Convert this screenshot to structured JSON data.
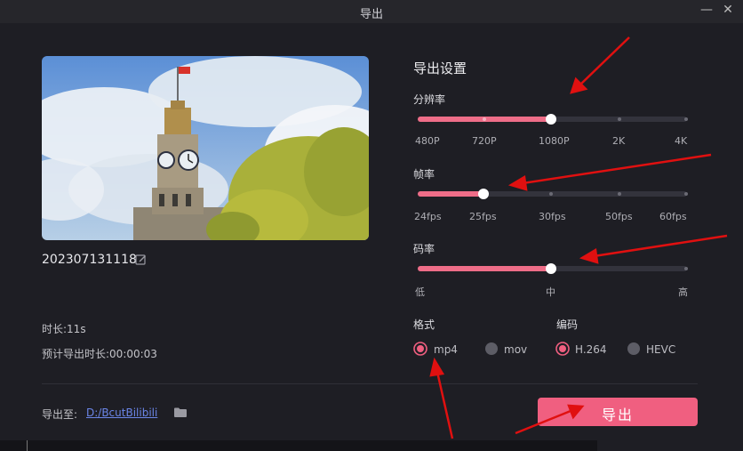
{
  "window": {
    "title": "导出",
    "minimize_icon": "minimize-icon",
    "close_icon": "close-icon"
  },
  "preview": {
    "image": "clock-tower-photo",
    "filename": "202307131118",
    "edit_icon": "pencil-edit-icon",
    "duration": "时长:11s",
    "estimated_export": "预计导出时长:00:00:03"
  },
  "settings": {
    "title": "导出设置",
    "resolution": {
      "label": "分辨率",
      "options": [
        "480P",
        "720P",
        "1080P",
        "2K",
        "4K"
      ],
      "selected": "1080P"
    },
    "framerate": {
      "label": "帧率",
      "options": [
        "24fps",
        "25fps",
        "30fps",
        "50fps",
        "60fps"
      ],
      "selected": "25fps"
    },
    "bitrate": {
      "label": "码率",
      "options": [
        "低",
        "中",
        "高"
      ],
      "selected": "中"
    },
    "format": {
      "label": "格式",
      "options": [
        "mp4",
        "mov"
      ],
      "selected": "mp4"
    },
    "codec": {
      "label": "编码",
      "options": [
        "H.264",
        "HEVC"
      ],
      "selected": "H.264"
    }
  },
  "footer": {
    "export_to_label": "导出至:",
    "path": "D:/BcutBilibili",
    "folder_icon": "folder-icon",
    "export_button": "导出"
  },
  "colors": {
    "accent": "#f05f80",
    "background": "#1e1e24",
    "annotation_arrow": "#e01010"
  }
}
